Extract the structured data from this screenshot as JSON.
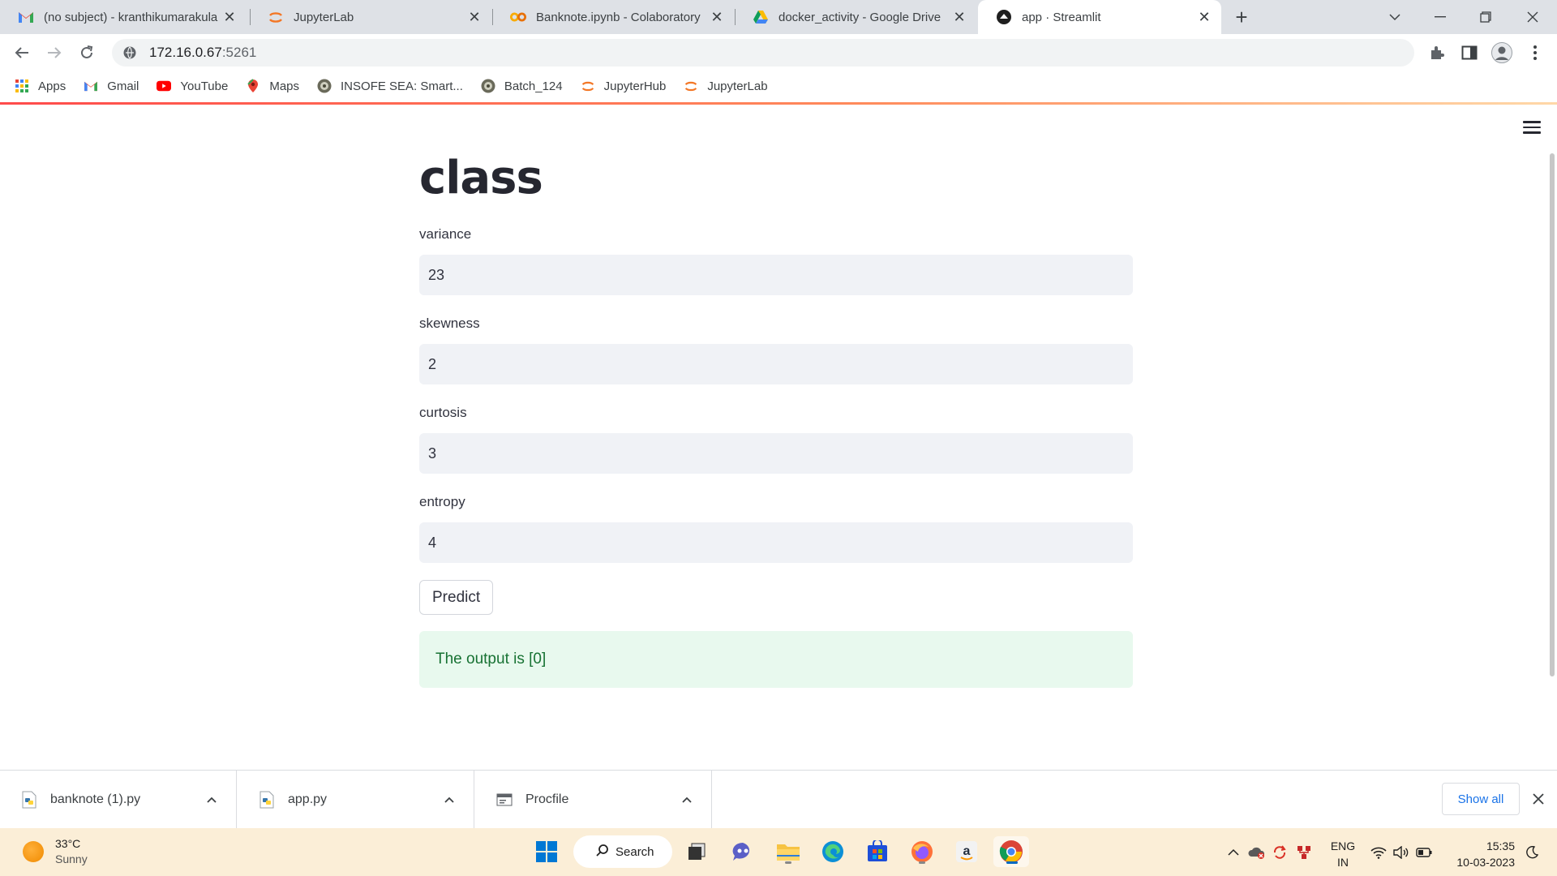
{
  "browser": {
    "tabs": [
      {
        "title": "(no subject) - kranthikumarakula",
        "icon": "gmail-icon"
      },
      {
        "title": "JupyterLab",
        "icon": "jupyter-icon"
      },
      {
        "title": "Banknote.ipynb - Colaboratory",
        "icon": "colab-icon"
      },
      {
        "title": "docker_activity - Google Drive",
        "icon": "drive-icon"
      },
      {
        "title": "app · Streamlit",
        "icon": "streamlit-icon",
        "active": true
      }
    ],
    "url_host": "172.16.0.67",
    "url_port": ":5261",
    "bookmarks": [
      {
        "label": "Apps",
        "icon": "apps-grid-icon"
      },
      {
        "label": "Gmail",
        "icon": "gmail-icon"
      },
      {
        "label": "YouTube",
        "icon": "youtube-icon"
      },
      {
        "label": "Maps",
        "icon": "maps-icon"
      },
      {
        "label": "INSOFE SEA: Smart...",
        "icon": "insofe-icon"
      },
      {
        "label": "Batch_124",
        "icon": "batch-icon"
      },
      {
        "label": "JupyterHub",
        "icon": "jupyter-icon"
      },
      {
        "label": "JupyterLab",
        "icon": "jupyter-icon"
      }
    ]
  },
  "app": {
    "title": "class",
    "fields": [
      {
        "label": "variance",
        "value": "23"
      },
      {
        "label": "skewness",
        "value": "2"
      },
      {
        "label": "curtosis",
        "value": "3"
      },
      {
        "label": "entropy",
        "value": "4"
      }
    ],
    "predict_label": "Predict",
    "result_text": "The output is [0]"
  },
  "downloads": {
    "items": [
      {
        "name": "banknote (1).py",
        "icon": "python-file-icon"
      },
      {
        "name": "app.py",
        "icon": "python-file-icon"
      },
      {
        "name": "Procfile",
        "icon": "file-icon"
      }
    ],
    "show_all": "Show all"
  },
  "taskbar": {
    "temperature": "33°C",
    "weather": "Sunny",
    "search_label": "Search",
    "lang_line1": "ENG",
    "lang_line2": "IN",
    "time": "15:35",
    "date": "10-03-2023"
  },
  "colors": {
    "accent_streamlit": "#ff4b4b",
    "success_bg": "#e8f9ee",
    "success_text": "#177233",
    "taskbar_bg": "#fbeed7"
  }
}
